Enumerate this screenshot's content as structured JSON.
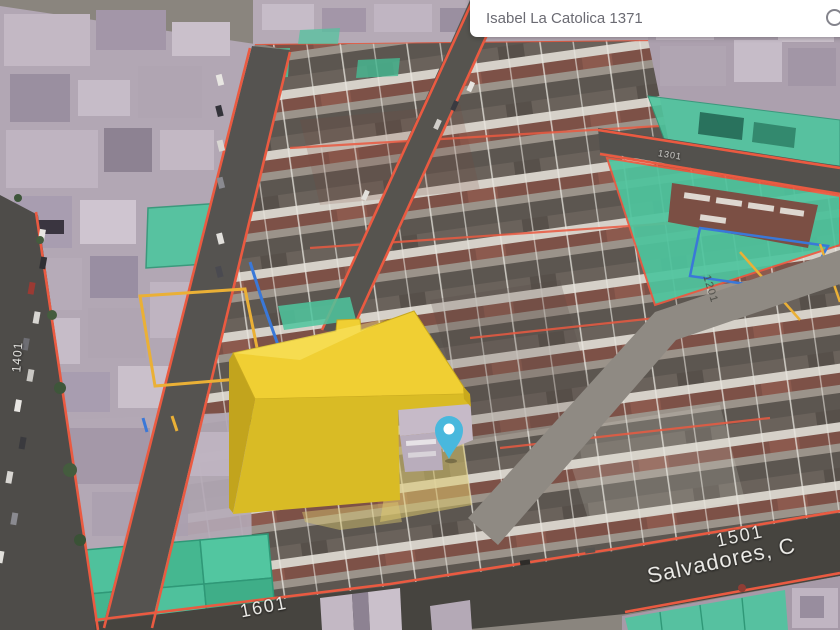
{
  "search_bar": {
    "value": "Isabel La Catolica 1371",
    "icon": "search-magnifier"
  },
  "map": {
    "view": "3d-aerial-cadastral",
    "street_labels": [
      {
        "text": "1401"
      },
      {
        "text": "1301"
      },
      {
        "text": "1201"
      },
      {
        "text": "1601"
      },
      {
        "text": "1501"
      },
      {
        "text": "Salvadores, C"
      }
    ],
    "marker": {
      "name": "location-pin",
      "color": "#49b8dd"
    },
    "selected_building": {
      "color": "#eecb2e",
      "label": "highlighted 3D building"
    },
    "overlay_colors": {
      "parcel_outline": "#ea5a41",
      "green_zone": "#4ec59e",
      "building_mass": "#b2a7b4",
      "lot_line_blue": "#3a78d8",
      "lot_line_amber": "#eab036"
    }
  }
}
